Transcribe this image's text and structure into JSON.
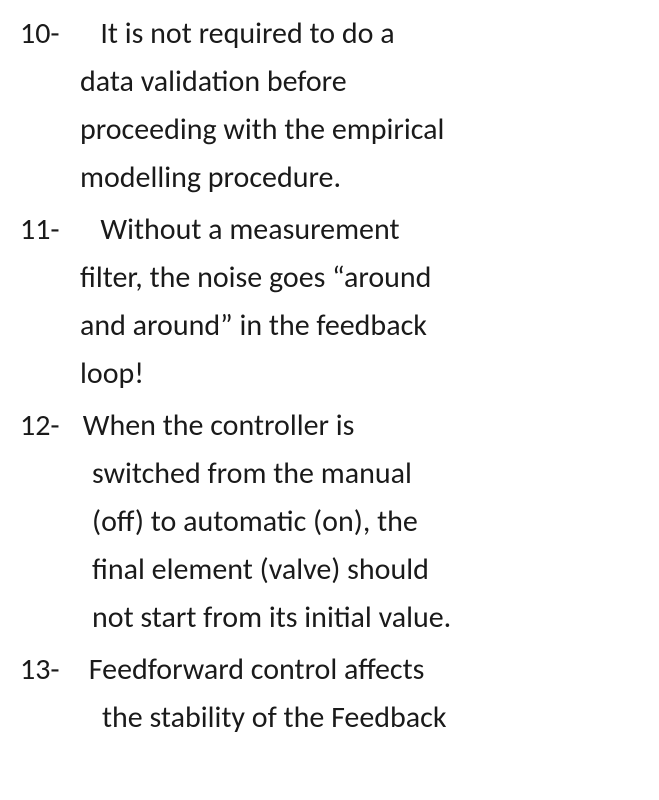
{
  "items": [
    {
      "number": "10-",
      "first": "It is not required to do a",
      "rest": [
        "data validation before",
        "proceeding with the empirical",
        "modelling procedure."
      ]
    },
    {
      "number": "11-",
      "first": "Without a measurement",
      "rest": [
        "filter, the noise goes “around",
        "and around” in the feedback",
        "loop!"
      ]
    },
    {
      "number": "12-",
      "first": "When the controller is",
      "rest": [
        "switched from the manual",
        "(off) to automatic (on), the",
        "final element (valve) should",
        "not start from its initial value."
      ]
    },
    {
      "number": "13-",
      "first": "Feedforward control affects",
      "rest": [
        "the stability of the Feedback"
      ]
    }
  ]
}
